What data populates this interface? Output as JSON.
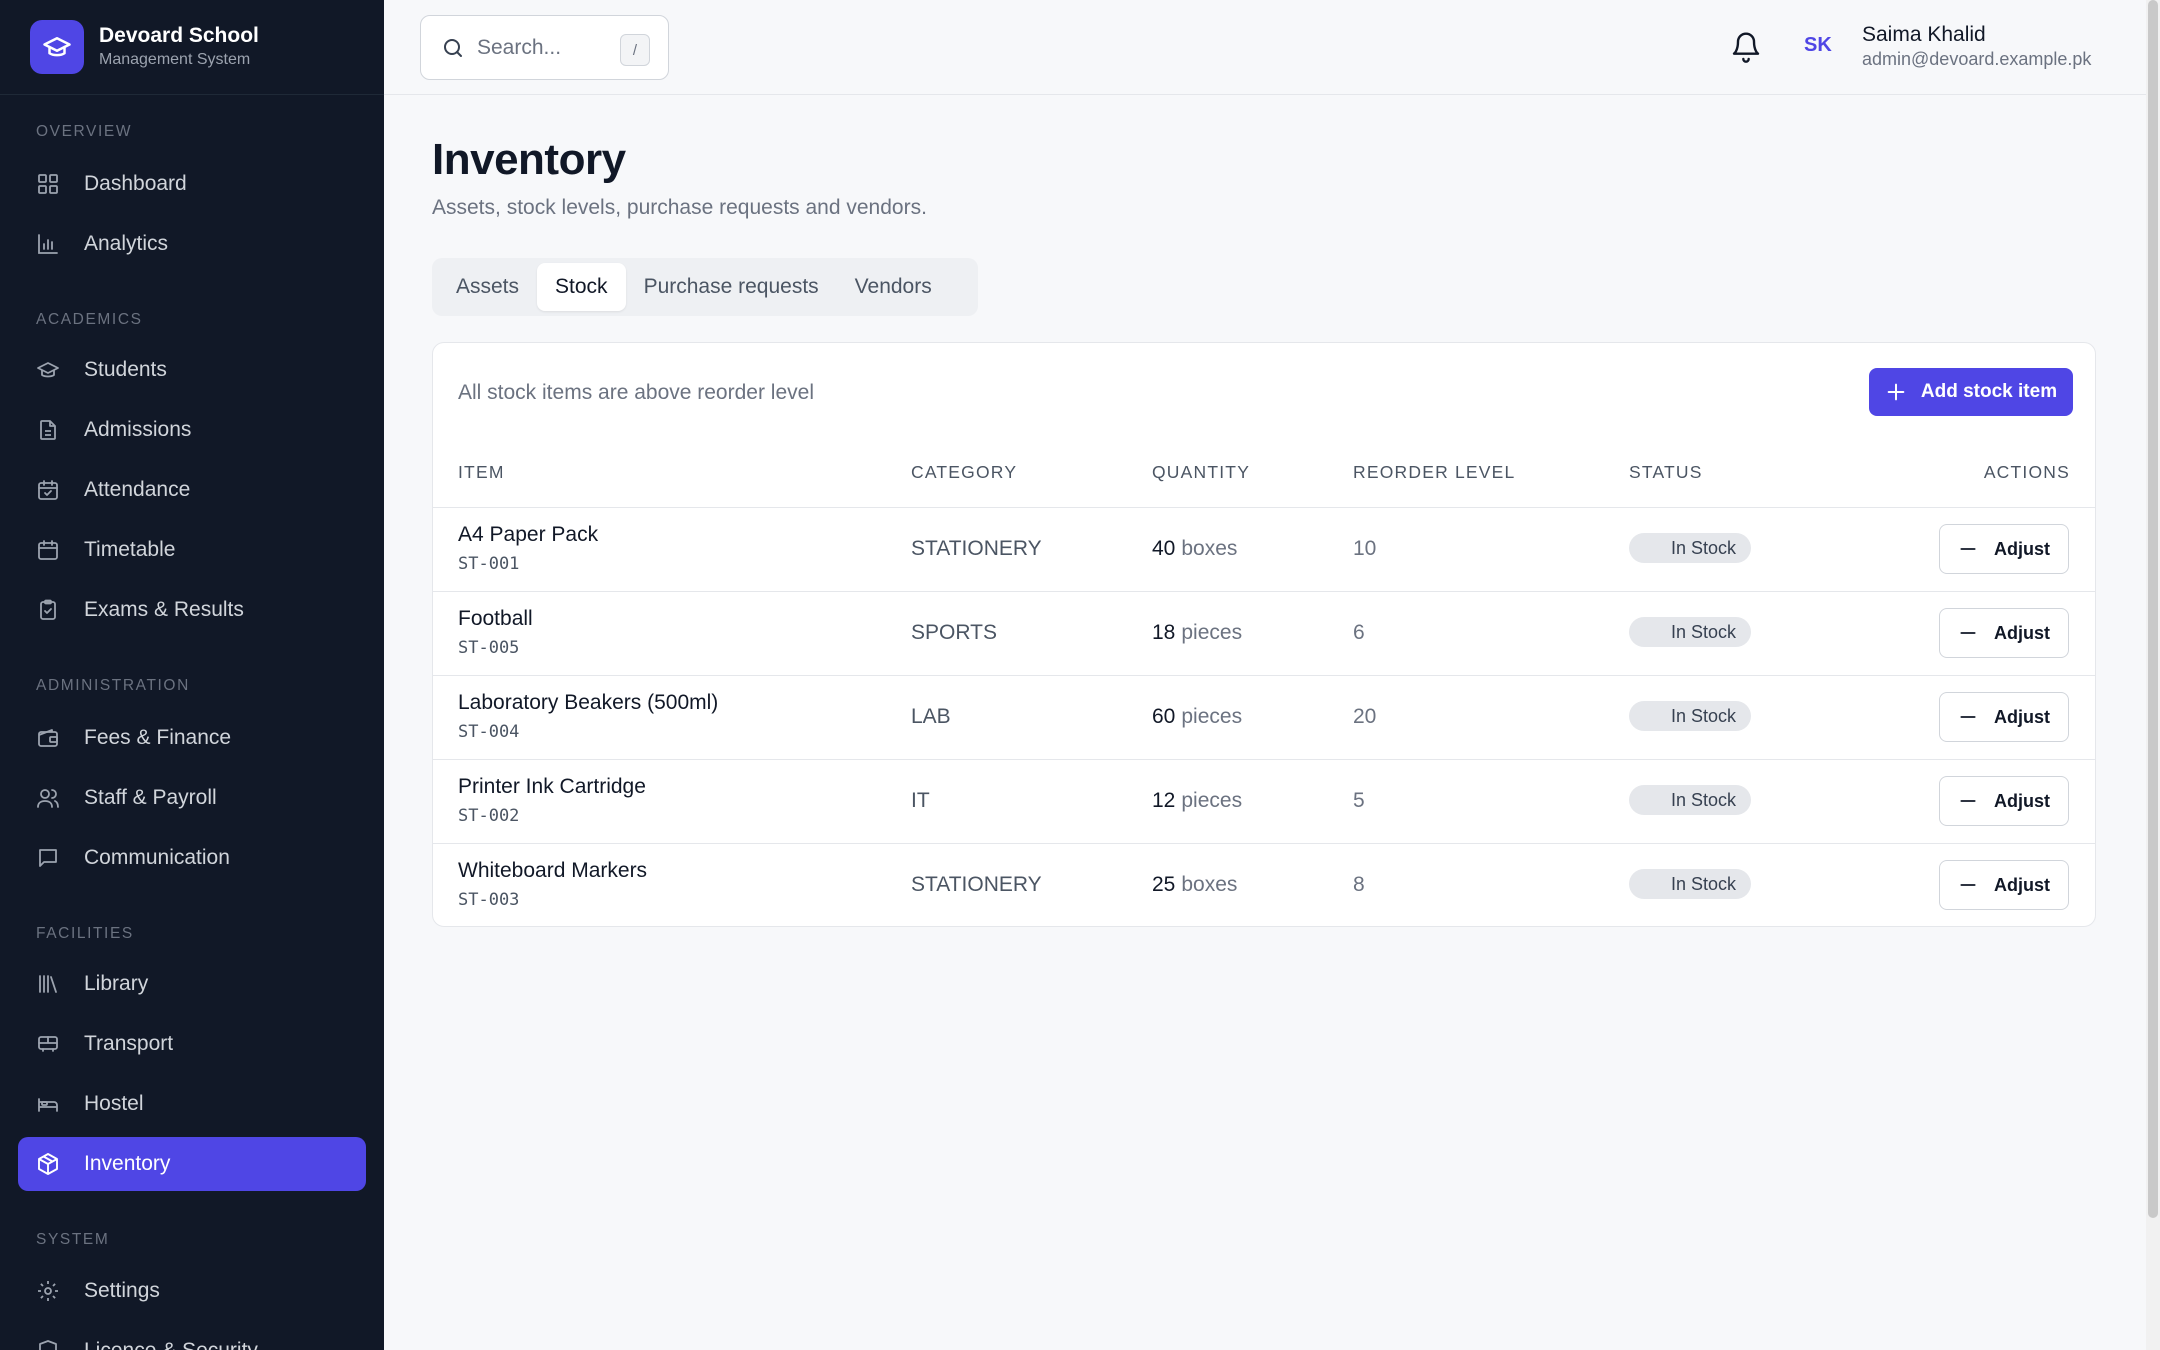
{
  "brand": {
    "name": "Devoard School",
    "subtitle": "Management System",
    "logo_icon": "graduation-cap-icon",
    "accent": "#4f46e5"
  },
  "sidebar": {
    "sections": [
      {
        "title": "OVERVIEW",
        "items": [
          {
            "label": "Dashboard",
            "icon": "grid-icon"
          },
          {
            "label": "Analytics",
            "icon": "bar-chart-icon"
          }
        ]
      },
      {
        "title": "ACADEMICS",
        "items": [
          {
            "label": "Students",
            "icon": "graduation-cap-icon"
          },
          {
            "label": "Admissions",
            "icon": "document-icon"
          },
          {
            "label": "Attendance",
            "icon": "calendar-check-icon"
          },
          {
            "label": "Timetable",
            "icon": "calendar-icon"
          },
          {
            "label": "Exams & Results",
            "icon": "clipboard-icon"
          }
        ]
      },
      {
        "title": "ADMINISTRATION",
        "items": [
          {
            "label": "Fees & Finance",
            "icon": "wallet-icon"
          },
          {
            "label": "Staff & Payroll",
            "icon": "users-icon"
          },
          {
            "label": "Communication",
            "icon": "message-icon"
          }
        ]
      },
      {
        "title": "FACILITIES",
        "items": [
          {
            "label": "Library",
            "icon": "library-icon"
          },
          {
            "label": "Transport",
            "icon": "bus-icon"
          },
          {
            "label": "Hostel",
            "icon": "bed-icon"
          },
          {
            "label": "Inventory",
            "icon": "package-icon",
            "active": true
          }
        ]
      },
      {
        "title": "SYSTEM",
        "items": [
          {
            "label": "Settings",
            "icon": "gear-icon"
          },
          {
            "label": "Licence & Security",
            "icon": "shield-icon"
          }
        ]
      }
    ]
  },
  "topbar": {
    "search_placeholder": "Search...",
    "search_shortcut": "/",
    "user": {
      "initials": "SK",
      "name": "Saima Khalid",
      "email": "admin@devoard.example.pk"
    }
  },
  "page": {
    "title": "Inventory",
    "subtitle": "Assets, stock levels, purchase requests and vendors.",
    "tabs": [
      {
        "label": "Assets"
      },
      {
        "label": "Stock",
        "active": true
      },
      {
        "label": "Purchase requests"
      },
      {
        "label": "Vendors"
      }
    ]
  },
  "stock": {
    "note": "All stock items are above reorder level",
    "add_label": "Add stock item",
    "columns": {
      "item": "ITEM",
      "category": "CATEGORY",
      "quantity": "QUANTITY",
      "reorder": "REORDER LEVEL",
      "status": "STATUS",
      "actions": "ACTIONS"
    },
    "rows": [
      {
        "name": "A4 Paper Pack",
        "code": "ST-001",
        "category": "STATIONERY",
        "qty": "40",
        "unit": "boxes",
        "reorder": "10",
        "status": "In Stock",
        "action": "Adjust"
      },
      {
        "name": "Football",
        "code": "ST-005",
        "category": "SPORTS",
        "qty": "18",
        "unit": "pieces",
        "reorder": "6",
        "status": "In Stock",
        "action": "Adjust"
      },
      {
        "name": "Laboratory Beakers (500ml)",
        "code": "ST-004",
        "category": "LAB",
        "qty": "60",
        "unit": "pieces",
        "reorder": "20",
        "status": "In Stock",
        "action": "Adjust"
      },
      {
        "name": "Printer Ink Cartridge",
        "code": "ST-002",
        "category": "IT",
        "qty": "12",
        "unit": "pieces",
        "reorder": "5",
        "status": "In Stock",
        "action": "Adjust"
      },
      {
        "name": "Whiteboard Markers",
        "code": "ST-003",
        "category": "STATIONERY",
        "qty": "25",
        "unit": "boxes",
        "reorder": "8",
        "status": "In Stock",
        "action": "Adjust"
      }
    ]
  }
}
